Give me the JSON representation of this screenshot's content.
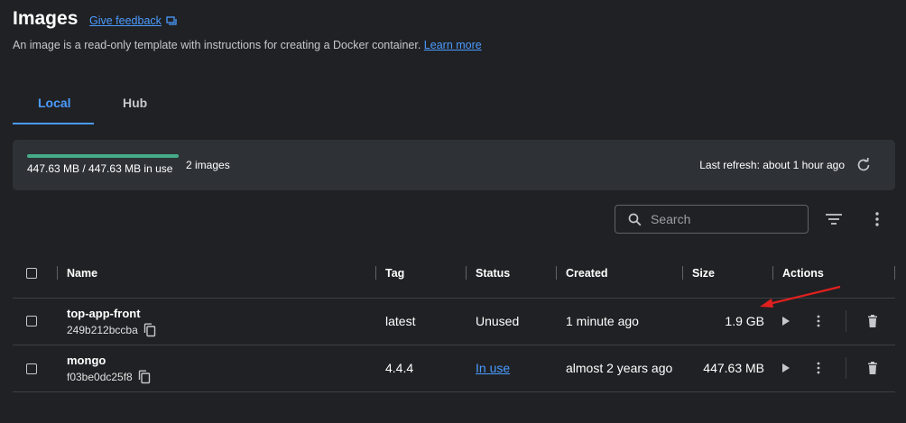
{
  "header": {
    "title": "Images",
    "feedback_label": "Give feedback",
    "subtitle": "An image is a read-only template with instructions for creating a Docker container.",
    "learn_more": "Learn more"
  },
  "tabs": [
    {
      "label": "Local",
      "active": true
    },
    {
      "label": "Hub",
      "active": false
    }
  ],
  "storage": {
    "usage_text": "447.63 MB / 447.63 MB in use",
    "usage_fraction": 1.0,
    "images_count": "2 images",
    "last_refresh": "Last refresh: about 1 hour ago"
  },
  "search": {
    "placeholder": "Search"
  },
  "table": {
    "columns": [
      "Name",
      "Tag",
      "Status",
      "Created",
      "Size",
      "Actions"
    ],
    "rows": [
      {
        "name": "top-app-front",
        "id": "249b212bccba",
        "tag": "latest",
        "status": "Unused",
        "created": "1 minute ago",
        "size": "1.9 GB"
      },
      {
        "name": "mongo",
        "id": "f03be0dc25f8",
        "tag": "4.4.4",
        "status": "In use",
        "created": "almost 2 years ago",
        "size": "447.63 MB"
      }
    ]
  },
  "colors": {
    "accent": "#4a9cff",
    "usage_bar": "#45ab88",
    "annotation_arrow": "#e0201f"
  }
}
